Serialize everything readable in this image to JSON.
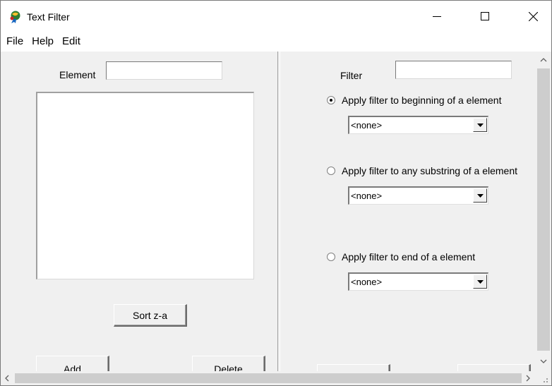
{
  "window": {
    "title": "Text Filter",
    "controls": {
      "minimize": "minimize-icon",
      "maximize": "maximize-icon",
      "close": "close-icon"
    }
  },
  "menu": [
    "File",
    "Help",
    "Edit"
  ],
  "left_panel": {
    "element_label": "Element",
    "element_value": "",
    "list_items": [],
    "sort_button": "Sort z-a",
    "add_button": "Add",
    "delete_button": "Delete"
  },
  "right_panel": {
    "filter_label": "Filter",
    "filter_value": "",
    "options": [
      {
        "label": "Apply filter to beginning of a element",
        "selected": true,
        "dropdown": "<none>"
      },
      {
        "label": "Apply filter to any substring of a element",
        "selected": false,
        "dropdown": "<none>"
      },
      {
        "label": "Apply filter to end of a element",
        "selected": false,
        "dropdown": "<none>"
      }
    ]
  },
  "colors": {
    "window_bg": "#f0f0f0",
    "titlebar_bg": "#ffffff",
    "scroll_thumb": "#cdcdcd"
  }
}
